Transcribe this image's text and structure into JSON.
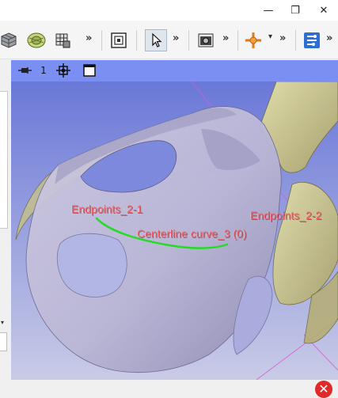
{
  "window": {
    "minimize_icon": "minimize-icon",
    "restore_icon": "restore-icon",
    "close_icon": "close-icon",
    "minimize_glyph": "—",
    "restore_glyph": "❐",
    "close_glyph": "✕"
  },
  "toolbar": {
    "overflow_glyph": "»",
    "dropdown_glyph": "▾"
  },
  "view": {
    "layout_number": "1",
    "background_top": "#6a78d8",
    "background_bottom": "#c9cbe6",
    "labels": {
      "endpoint_1": "Endpoints_2-1",
      "endpoint_2": "Endpoints_2-2",
      "centerline": "Centerline curve_3 (0)"
    },
    "centerline_color": "#22dd22",
    "label_color": "#f0606a"
  },
  "bottom": {
    "close_glyph": "✕"
  }
}
